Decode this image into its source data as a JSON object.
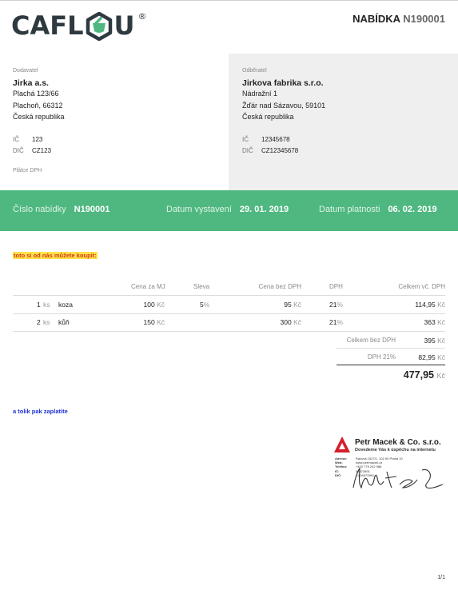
{
  "logo": {
    "text_left": "CAFL",
    "text_right": "U",
    "mark": "®"
  },
  "document": {
    "title": "NABÍDKA",
    "number": "N190001"
  },
  "supplier": {
    "label": "Dodavatel",
    "name": "Jirka a.s.",
    "street": "Plachá 123/66",
    "city": "Plachoň, 66312",
    "country": "Česká republika",
    "ic_label": "IČ",
    "ic": "123",
    "dic_label": "DIČ",
    "dic": "CZ123",
    "vat_status": "Plátce DPH"
  },
  "customer": {
    "label": "Odběratel",
    "name": "Jirkova fabrika s.r.o.",
    "street": "Nádražní 1",
    "city": "Žďár nad Sázavou, 59101",
    "country": "Česká republika",
    "ic_label": "IČ",
    "ic": "12345678",
    "dic_label": "DIČ",
    "dic": "CZ12345678"
  },
  "band": {
    "number_label": "Číslo nabídky",
    "number": "N190001",
    "issued_label": "Datum vystavení",
    "issued": "29. 01. 2019",
    "valid_label": "Datum platnosti",
    "valid": "06. 02. 2019"
  },
  "note_top": "toto si od nás můžete koupit:",
  "table": {
    "headers": {
      "unit_price": "Cena za MJ",
      "discount": "Sleva",
      "net": "Cena bez DPH",
      "vat": "DPH",
      "total": "Celkem vč. DPH"
    },
    "rows": [
      {
        "qty": "1",
        "unit": "ks",
        "item": "koza",
        "unit_price": "100",
        "currency": "Kč",
        "discount": "5",
        "discount_unit": "%",
        "net": "95",
        "vat": "21",
        "vat_unit": "%",
        "total": "114,95"
      },
      {
        "qty": "2",
        "unit": "ks",
        "item": "kůň",
        "unit_price": "150",
        "currency": "Kč",
        "discount": "",
        "discount_unit": "",
        "net": "300",
        "vat": "21",
        "vat_unit": "%",
        "total": "363"
      }
    ]
  },
  "summary": {
    "net_label": "Celkem bez DPH",
    "net": "395",
    "currency": "Kč",
    "vat_label": "DPH 21%",
    "vat": "82,95",
    "grand": "477,95"
  },
  "note_bottom": "a tolik pak zaplatíte",
  "stamp": {
    "company": "Petr Macek & Co. s.r.o.",
    "slogan": "Dovedeme Vás k úspěchu na internetu",
    "lines": [
      {
        "k": "Adresa:",
        "v": "Rázová 1527/1, 102 00 Praha 10"
      },
      {
        "k": "Web:",
        "v": "www.petrmacek.cz"
      },
      {
        "k": "Telefon:",
        "v": "+420 775 242 988"
      },
      {
        "k": "IČ:",
        "v": "04672891"
      },
      {
        "k": "DIČ:",
        "v": "CZ04672891"
      }
    ]
  },
  "pager": "1/1",
  "colors": {
    "band": "#4fb881",
    "logo": "#2e3a40",
    "logo_accent": "#4fb881",
    "highlight": "#ffe24a",
    "note_top": "#d43a1f",
    "note_bottom": "#1f33d6",
    "stamp_red": "#d41e2a"
  }
}
